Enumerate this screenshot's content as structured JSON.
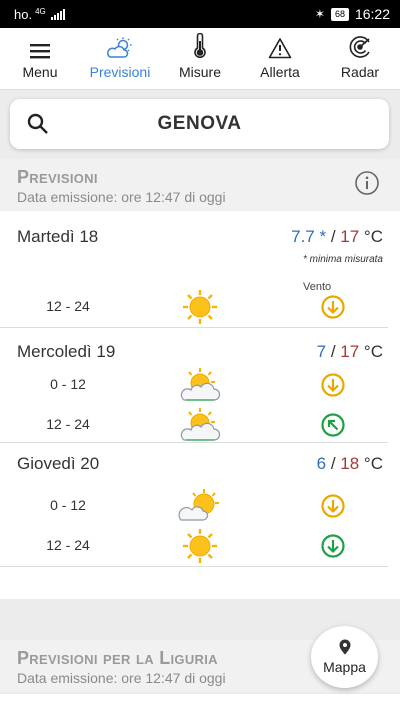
{
  "status_bar": {
    "carrier": "ho.",
    "network": "4G",
    "battery": "68",
    "time": "16:22"
  },
  "nav": [
    {
      "label": "Menu",
      "icon": "hamburger-icon",
      "active": false
    },
    {
      "label": "Previsioni",
      "icon": "partly-cloudy-icon",
      "active": true
    },
    {
      "label": "Misure",
      "icon": "thermometer-icon",
      "active": false
    },
    {
      "label": "Allerta",
      "icon": "warning-icon",
      "active": false
    },
    {
      "label": "Radar",
      "icon": "radar-icon",
      "active": false
    }
  ],
  "search": {
    "city": "GENOVA",
    "icon": "search-icon"
  },
  "forecast": {
    "title": "Previsioni",
    "emission": "Data emissione: ore 12:47 di oggi",
    "vento_label": "Vento",
    "unit": "°C",
    "days": [
      {
        "name": "Martedì 18",
        "tmin": "7.7 *",
        "tmax": "17",
        "note": "* minima misurata",
        "slots": [
          {
            "time": "12 - 24",
            "weather": "sunny-icon",
            "wind": "wind-south-icon",
            "wind_color": "#e8a800"
          }
        ]
      },
      {
        "name": "Mercoledì 19",
        "tmin": "7",
        "tmax": "17",
        "slots": [
          {
            "time": "0 - 12",
            "weather": "partly-cloudy-icon",
            "wind": "wind-south-icon",
            "wind_color": "#e8a800"
          },
          {
            "time": "12 - 24",
            "weather": "partly-cloudy-icon",
            "wind": "wind-northwest-icon",
            "wind_color": "#1fa043"
          }
        ]
      },
      {
        "name": "Giovedì 20",
        "tmin": "6",
        "tmax": "18",
        "slots": [
          {
            "time": "0 - 12",
            "weather": "sun-cloud-icon",
            "wind": "wind-south-icon",
            "wind_color": "#e8a800"
          },
          {
            "time": "12 - 24",
            "weather": "sunny-icon",
            "wind": "wind-south-icon",
            "wind_color": "#1fa043"
          }
        ]
      }
    ]
  },
  "liguria": {
    "title": "Previsioni per la Liguria",
    "emission": "Data emissione: ore 12:47 di oggi"
  },
  "map_button": {
    "label": "Mappa",
    "icon": "map-pin-icon"
  },
  "colors": {
    "accent": "#3b82d6",
    "tmin": "#2f6db5",
    "tmax": "#a33a3a"
  }
}
